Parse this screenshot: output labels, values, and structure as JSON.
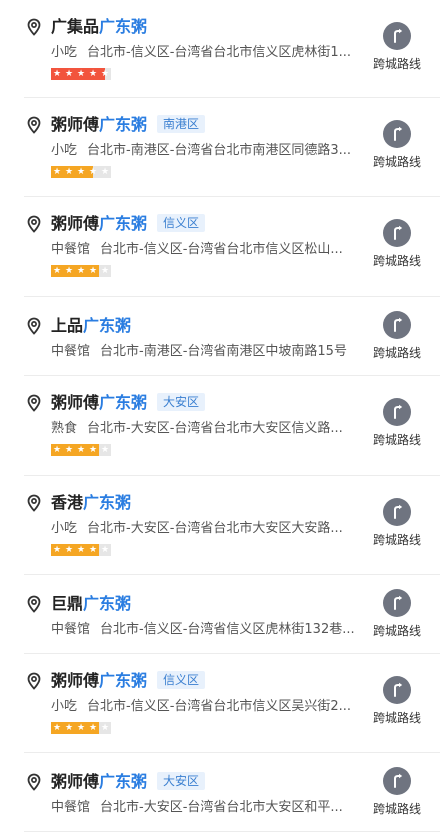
{
  "accent": "#2a7de1",
  "star_colors": {
    "red": "#f2543d",
    "orange": "#f5a623",
    "empty": "#e6e6e6"
  },
  "items": [
    {
      "prefix": "广集品",
      "keyword": "广东粥",
      "district_badge": "",
      "category": "小吃",
      "address": "台北市-信义区-台湾省台北市信义区虎林街1...",
      "rating": 4.5,
      "star_color": "red",
      "action_label": "跨城路线"
    },
    {
      "prefix": "粥师傅",
      "keyword": "广东粥",
      "district_badge": "南港区",
      "category": "小吃",
      "address": "台北市-南港区-台湾省台北市南港区同德路3...",
      "rating": 3.5,
      "star_color": "orange",
      "action_label": "跨城路线"
    },
    {
      "prefix": "粥师傅",
      "keyword": "广东粥",
      "district_badge": "信义区",
      "category": "中餐馆",
      "address": "台北市-信义区-台湾省台北市信义区松山...",
      "rating": 4,
      "star_color": "orange",
      "action_label": "跨城路线"
    },
    {
      "prefix": "上品",
      "keyword": "广东粥",
      "district_badge": "",
      "category": "中餐馆",
      "address": "台北市-南港区-台湾省南港区中坡南路15号",
      "rating": null,
      "star_color": "",
      "action_label": "跨城路线"
    },
    {
      "prefix": "粥师傅",
      "keyword": "广东粥",
      "district_badge": "大安区",
      "category": "熟食",
      "address": "台北市-大安区-台湾省台北市大安区信义路...",
      "rating": 4,
      "star_color": "orange",
      "action_label": "跨城路线"
    },
    {
      "prefix": "香港",
      "keyword": "广东粥",
      "district_badge": "",
      "category": "小吃",
      "address": "台北市-大安区-台湾省台北市大安区大安路...",
      "rating": 4,
      "star_color": "orange",
      "action_label": "跨城路线"
    },
    {
      "prefix": "巨鼎",
      "keyword": "广东粥",
      "district_badge": "",
      "category": "中餐馆",
      "address": "台北市-信义区-台湾省信义区虎林街132巷...",
      "rating": null,
      "star_color": "",
      "action_label": "跨城路线"
    },
    {
      "prefix": "粥师傅",
      "keyword": "广东粥",
      "district_badge": "信义区",
      "category": "小吃",
      "address": "台北市-信义区-台湾省台北市信义区吴兴街2...",
      "rating": 4,
      "star_color": "orange",
      "action_label": "跨城路线"
    },
    {
      "prefix": "粥师傅",
      "keyword": "广东粥",
      "district_badge": "大安区",
      "category": "中餐馆",
      "address": "台北市-大安区-台湾省台北市大安区和平...",
      "rating": null,
      "star_color": "",
      "action_label": "跨城路线"
    }
  ]
}
